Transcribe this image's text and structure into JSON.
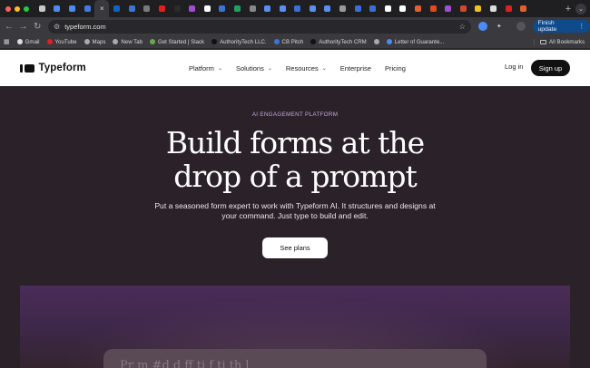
{
  "browser": {
    "tab_colors": [
      "#c7c7c7",
      "#4b8bf5",
      "#4b8bf5",
      "#3f7be0",
      "#ffffff",
      "#0a66c2",
      "#3a74d9",
      "#7a7a7a",
      "#e02020",
      "#2b2b2b",
      "#a04fd0",
      "#ffffff",
      "#3a74d9",
      "#20a060",
      "#888888",
      "#5a8ef0",
      "#5a8ef0",
      "#3a6fd8",
      "#5a8ef0",
      "#5a8ef0",
      "#999999",
      "#3a6fd8",
      "#3a6fd8",
      "#ffffff",
      "#ffffff",
      "#e06030",
      "#e04a20",
      "#a04fd0",
      "#d04a30",
      "#f0c020",
      "#dddddd",
      "#e02020",
      "#e06030"
    ],
    "active_tab_index": 4,
    "active_tab_close": "×",
    "new_tab": "+",
    "tab_menu": "⌄",
    "back": "←",
    "forward": "→",
    "reload": "↻",
    "url": "typeform.com",
    "finish_update_label": "Finish update",
    "finish_update_menu": "⋮",
    "bookmarks": [
      {
        "label": "Gmail",
        "color": "#dddddd"
      },
      {
        "label": "YouTube",
        "color": "#e02020"
      },
      {
        "label": "Maps",
        "color": "#aaaaaa"
      },
      {
        "label": "New Tab",
        "color": "#aaaaaa"
      },
      {
        "label": "Get Started | Slack",
        "color": "#6aa84f"
      },
      {
        "label": "AuthorityTech LLC.",
        "color": "#111111"
      },
      {
        "label": "CB Pitch",
        "color": "#3a74d9"
      },
      {
        "label": "AuthorityTech CRM",
        "color": "#111111"
      },
      {
        "label": "",
        "color": "#aaaaaa"
      },
      {
        "label": "Letter of Guarante...",
        "color": "#4b8bf5"
      }
    ],
    "all_bookmarks_label": "All Bookmarks"
  },
  "header": {
    "logo_text": "Typeform",
    "nav": [
      {
        "label": "Platform",
        "has_menu": true
      },
      {
        "label": "Solutions",
        "has_menu": true
      },
      {
        "label": "Resources",
        "has_menu": true
      },
      {
        "label": "Enterprise",
        "has_menu": false
      },
      {
        "label": "Pricing",
        "has_menu": false
      }
    ],
    "chevron": "⌄",
    "login_label": "Log in",
    "signup_label": "Sign up"
  },
  "hero": {
    "eyebrow": "AI ENGAGEMENT PLATFORM",
    "headline_line1": "Build forms at the",
    "headline_line2": "drop of a prompt",
    "subtext": "Put a seasoned form expert to work with Typeform AI. It structures and designs at your command. Just type to build and edit.",
    "cta_label": "See plans",
    "prompt_partial": "Pr m   #d   d ff   ti     f     ti     th    l"
  },
  "colors": {
    "hero_bg": "#2a2228",
    "eyebrow": "#c6a8e6",
    "accent_dark": "#111111",
    "update_button": "#0f4a8a"
  }
}
